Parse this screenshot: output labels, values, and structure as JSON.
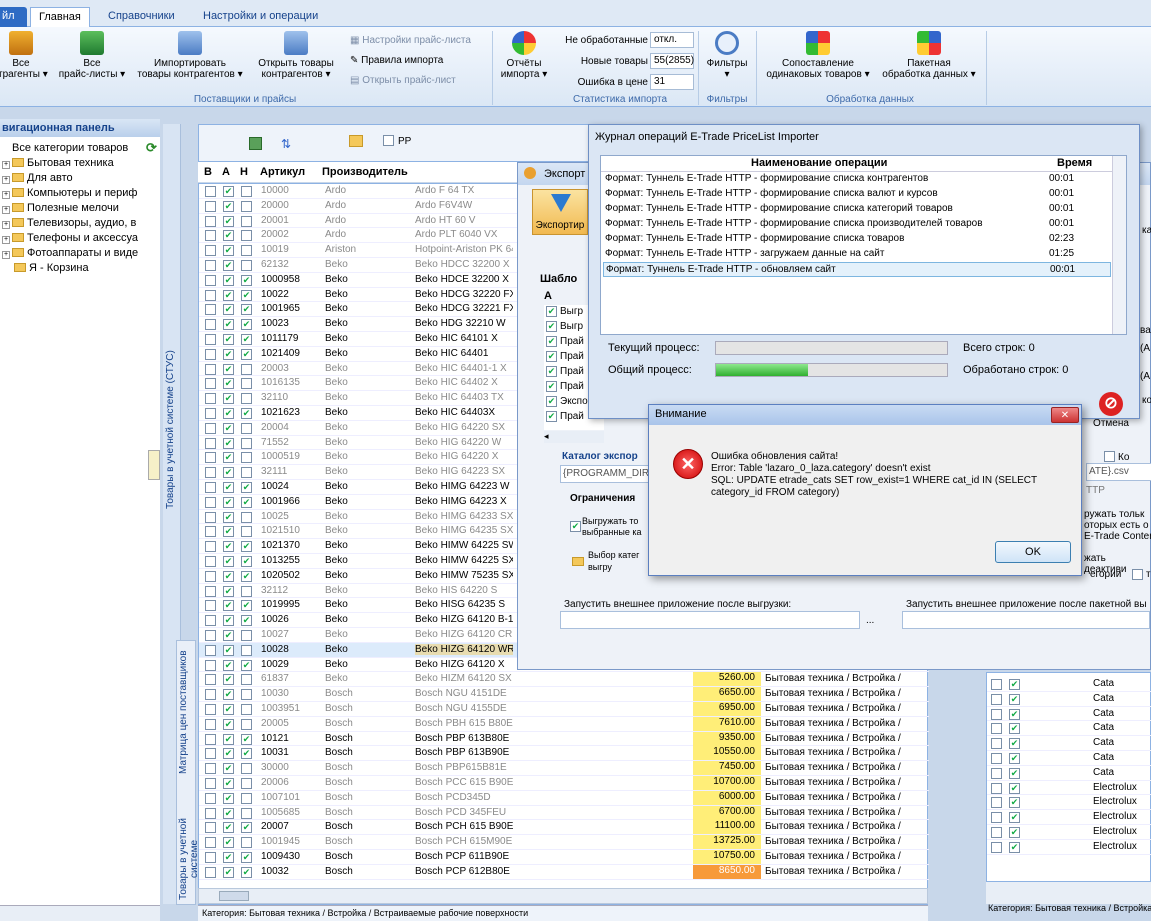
{
  "ribbon": {
    "tabs": [
      "йл",
      "Главная",
      "Справочники",
      "Настройки и операции"
    ],
    "buttons": {
      "all_contractors": "Все\nтрагенты ▾",
      "all_pricelists": "Все\nпрайс-листы ▾",
      "import": "Импортировать\nтовары контрагентов ▾",
      "open_goods": "Открыть товары\nконтрагентов ▾",
      "pricelist_settings": "Настройки прайс-листа",
      "import_rules": "Правила импорта",
      "open_pricelist": "Открыть прайс-лист",
      "import_reports": "Отчёты\nимпорта ▾",
      "filters": "Фильтры\n▾",
      "match": "Сопоставление\nодинаковых товаров ▾",
      "batch": "Пакетная\nобработка данных ▾"
    },
    "stats": {
      "unprocessed_label": "Не обработанные",
      "unprocessed_value": "откл.",
      "new_label": "Новые товары",
      "new_value": "55(2855)",
      "price_err_label": "Ошибка в цене",
      "price_err_value": "31"
    },
    "groups": [
      "Поставщики и прайсы",
      "Статистика импорта",
      "Фильтры",
      "Обработка данных"
    ]
  },
  "nav": {
    "title": "вигационная панель",
    "items": [
      "Все категории товаров",
      "Бытовая техника",
      "Для авто",
      "Компьютеры и периф",
      "Полезные мелочи",
      "Телевизоры, аудио, в",
      "Телефоны и аксессуа",
      "Фотоаппараты и виде",
      "Я - Корзина"
    ]
  },
  "side_tabs": {
    "top": "Товары в учетной системе (СТУС)",
    "matrix": "Матрица цен поставщиков",
    "bottom": "Товары в учетной системе"
  },
  "grid": {
    "toolbar_pp": "PP",
    "headers": [
      "В",
      "А",
      "Н",
      "Артикул",
      "Производитель"
    ],
    "rows": [
      {
        "a": true,
        "n": false,
        "art": "10000",
        "mfr": "Ardo",
        "name": "Ardo F 64 TX",
        "gray": true
      },
      {
        "a": true,
        "n": false,
        "art": "20000",
        "mfr": "Ardo",
        "name": "Ardo F6V4W",
        "gray": true
      },
      {
        "a": true,
        "n": false,
        "art": "20001",
        "mfr": "Ardo",
        "name": "Ardo HT 60 V",
        "gray": true
      },
      {
        "a": true,
        "n": false,
        "art": "20002",
        "mfr": "Ardo",
        "name": "Ardo PLT 6040 VX",
        "gray": true
      },
      {
        "a": true,
        "n": false,
        "art": "10019",
        "mfr": "Ariston",
        "name": "Hotpoint-Ariston PK 64",
        "gray": true
      },
      {
        "a": true,
        "n": false,
        "art": "62132",
        "mfr": "Beko",
        "name": "Beko HDCC 32200 X",
        "gray": true
      },
      {
        "a": true,
        "n": true,
        "art": "1000958",
        "mfr": "Beko",
        "name": "Beko HDCE 32200 X",
        "gray": false
      },
      {
        "a": true,
        "n": true,
        "art": "10022",
        "mfr": "Beko",
        "name": "Beko HDCG 32220 FX",
        "gray": false
      },
      {
        "a": true,
        "n": true,
        "art": "1001965",
        "mfr": "Beko",
        "name": "Beko HDCG 32221 FX",
        "gray": false
      },
      {
        "a": true,
        "n": true,
        "art": "10023",
        "mfr": "Beko",
        "name": "Beko HDG 32210 W",
        "gray": false
      },
      {
        "a": true,
        "n": true,
        "art": "1011179",
        "mfr": "Beko",
        "name": "Beko HIC 64101 X",
        "gray": false
      },
      {
        "a": true,
        "n": true,
        "art": "1021409",
        "mfr": "Beko",
        "name": "Beko HIC 64401",
        "gray": false
      },
      {
        "a": true,
        "n": false,
        "art": "20003",
        "mfr": "Beko",
        "name": "Beko HIC 64401-1 X",
        "gray": true
      },
      {
        "a": true,
        "n": false,
        "art": "1016135",
        "mfr": "Beko",
        "name": "Beko HIC 64402 X",
        "gray": true
      },
      {
        "a": true,
        "n": false,
        "art": "32110",
        "mfr": "Beko",
        "name": "Beko HIC 64403 TX",
        "gray": true
      },
      {
        "a": true,
        "n": true,
        "art": "1021623",
        "mfr": "Beko",
        "name": "Beko HIC 64403X",
        "gray": false
      },
      {
        "a": true,
        "n": false,
        "art": "20004",
        "mfr": "Beko",
        "name": "Beko HIG 64220 SX",
        "gray": true
      },
      {
        "a": true,
        "n": false,
        "art": "71552",
        "mfr": "Beko",
        "name": "Beko HIG 64220 W",
        "gray": true
      },
      {
        "a": true,
        "n": false,
        "art": "1000519",
        "mfr": "Beko",
        "name": "Beko HIG 64220 X",
        "gray": true
      },
      {
        "a": true,
        "n": false,
        "art": "32111",
        "mfr": "Beko",
        "name": "Beko HIG 64223 SX",
        "gray": true
      },
      {
        "a": true,
        "n": true,
        "art": "10024",
        "mfr": "Beko",
        "name": "Beko HIMG 64223 W",
        "gray": false
      },
      {
        "a": true,
        "n": true,
        "art": "1001966",
        "mfr": "Beko",
        "name": "Beko HIMG 64223 X",
        "gray": false
      },
      {
        "a": true,
        "n": false,
        "art": "10025",
        "mfr": "Beko",
        "name": "Beko HIMG 64233 SX",
        "gray": true
      },
      {
        "a": true,
        "n": false,
        "art": "1021510",
        "mfr": "Beko",
        "name": "Beko HIMG 64235 SX",
        "gray": true
      },
      {
        "a": true,
        "n": true,
        "art": "1021370",
        "mfr": "Beko",
        "name": "Beko HIMW 64225 SW",
        "gray": false
      },
      {
        "a": true,
        "n": true,
        "art": "1013255",
        "mfr": "Beko",
        "name": "Beko HIMW 64225 SX",
        "gray": false
      },
      {
        "a": true,
        "n": true,
        "art": "1020502",
        "mfr": "Beko",
        "name": "Beko HIMW 75235 SX",
        "gray": false
      },
      {
        "a": true,
        "n": false,
        "art": "32112",
        "mfr": "Beko",
        "name": "Beko HIS 64220 S",
        "gray": true
      },
      {
        "a": true,
        "n": true,
        "art": "1019995",
        "mfr": "Beko",
        "name": "Beko HISG 64235 S",
        "gray": false
      },
      {
        "a": true,
        "n": true,
        "art": "10026",
        "mfr": "Beko",
        "name": "Beko HIZG 64120 B-1",
        "gray": false
      },
      {
        "a": true,
        "n": false,
        "art": "10027",
        "mfr": "Beko",
        "name": "Beko HIZG 64120 CR",
        "gray": true
      },
      {
        "a": true,
        "n": false,
        "art": "10028",
        "mfr": "Beko",
        "name": "Beko HIZG 64120 WR",
        "gray": false,
        "sel": true
      },
      {
        "a": true,
        "n": true,
        "art": "10029",
        "mfr": "Beko",
        "name": "Beko HIZG 64120 X",
        "gray": false
      },
      {
        "a": true,
        "n": false,
        "art": "61837",
        "mfr": "Beko",
        "name": "Beko HIZM 64120 SX",
        "gray": true,
        "price": "5260.00",
        "cat": "Бытовая техника / Встройка /"
      },
      {
        "a": true,
        "n": false,
        "art": "10030",
        "mfr": "Bosch",
        "name": "Bosch NGU 4151DE",
        "gray": true,
        "price": "6650.00",
        "cat": "Бытовая техника / Встройка /"
      },
      {
        "a": true,
        "n": false,
        "art": "1003951",
        "mfr": "Bosch",
        "name": "Bosch NGU 4155DE",
        "gray": true,
        "price": "6950.00",
        "cat": "Бытовая техника / Встройка /"
      },
      {
        "a": true,
        "n": false,
        "art": "20005",
        "mfr": "Bosch",
        "name": "Bosch PBH 615 B80E",
        "gray": true,
        "price": "7610.00",
        "cat": "Бытовая техника / Встройка /"
      },
      {
        "a": true,
        "n": true,
        "art": "10121",
        "mfr": "Bosch",
        "name": "Bosch PBP 613B80E",
        "gray": false,
        "price": "9350.00",
        "cat": "Бытовая техника / Встройка /"
      },
      {
        "a": true,
        "n": true,
        "art": "10031",
        "mfr": "Bosch",
        "name": "Bosch PBP 613B90E",
        "gray": false,
        "price": "10550.00",
        "cat": "Бытовая техника / Встройка /"
      },
      {
        "a": true,
        "n": false,
        "art": "30000",
        "mfr": "Bosch",
        "name": "Bosch PBP615B81E",
        "gray": true,
        "price": "7450.00",
        "cat": "Бытовая техника / Встройка /"
      },
      {
        "a": true,
        "n": false,
        "art": "20006",
        "mfr": "Bosch",
        "name": "Bosch PCC 615 B90E",
        "gray": true,
        "price": "10700.00",
        "cat": "Бытовая техника / Встройка /"
      },
      {
        "a": true,
        "n": false,
        "art": "1007101",
        "mfr": "Bosch",
        "name": "Bosch PCD345D",
        "gray": true,
        "price": "6000.00",
        "cat": "Бытовая техника / Встройка /"
      },
      {
        "a": true,
        "n": false,
        "art": "1005685",
        "mfr": "Bosch",
        "name": "Bosch PCD 345FEU",
        "gray": true,
        "price": "6700.00",
        "cat": "Бытовая техника / Встройка /"
      },
      {
        "a": true,
        "n": true,
        "art": "20007",
        "mfr": "Bosch",
        "name": "Bosch PCH 615 B90E",
        "gray": false,
        "price": "11100.00",
        "cat": "Бытовая техника / Встройка /"
      },
      {
        "a": true,
        "n": false,
        "art": "1001945",
        "mfr": "Bosch",
        "name": "Bosch PCH 615M90E",
        "gray": true,
        "price": "13725.00",
        "cat": "Бытовая техника / Встройка /"
      },
      {
        "a": true,
        "n": true,
        "art": "1009430",
        "mfr": "Bosch",
        "name": "Bosch PCP 611B90E",
        "gray": false,
        "price": "10750.00",
        "cat": "Бытовая техника / Встройка /"
      },
      {
        "a": true,
        "n": true,
        "art": "10032",
        "mfr": "Bosch",
        "name": "Bosch PCP 612B80E",
        "gray": false,
        "price": "8650.00",
        "cat": "Бытовая техника / Встройка /",
        "orange": true
      }
    ]
  },
  "right_grid": {
    "rows": [
      "Cata",
      "Cata",
      "Cata",
      "Cata",
      "Cata",
      "Cata",
      "Cata",
      "Electrolux",
      "Electrolux",
      "Electrolux",
      "Electrolux",
      "Electrolux"
    ],
    "status": "Категория: Бытовая техника / Встройка /"
  },
  "status": "Категория: Бытовая техника / Встройка / Встраиваемые рабочие поверхности",
  "export_window": {
    "title": "Экспорт",
    "button": "Экспортир",
    "template": "Шабло",
    "col_a": "А",
    "rows": [
      "Выгр",
      "Выгр",
      "Прай",
      "Прай",
      "Прай",
      "Прай",
      "Экспо",
      "Прай"
    ],
    "catalog_label": "Каталог экспор",
    "catalog_value": "{PROGRAMM_DIR}",
    "limits": "Ограничения",
    "upload_selected": "Выгружать то\nвыбранные ка",
    "choose_cat": "Выбор катег\nвыгру",
    "run_after": "Запустить внешнее приложение после выгрузки:",
    "run_after_batch": "Запустить внешнее приложение после пакетной вы",
    "browse": "...",
    "right_texts": [
      "Ко",
      "ATE}.csv",
      "TTP",
      "ружать тольк\nоторых есть о\nE-Trade Conter",
      "жать деактиви",
      "егории",
      "т",
      "вар",
      "(А",
      "(А",
      "ко",
      "ка"
    ]
  },
  "journal": {
    "title": "Журнал операций E-Trade PriceList Importer",
    "col_name": "Наименование операции",
    "col_time": "Время",
    "rows": [
      {
        "name": "Формат: Туннель E-Trade HTTP - формирование списка контрагентов",
        "time": "00:01"
      },
      {
        "name": "Формат: Туннель E-Trade HTTP - формирование списка валют и курсов",
        "time": "00:01"
      },
      {
        "name": "Формат: Туннель E-Trade HTTP - формирование списка категорий товаров",
        "time": "00:01"
      },
      {
        "name": "Формат: Туннель E-Trade HTTP - формирование списка производителей товаров",
        "time": "00:01"
      },
      {
        "name": "Формат: Туннель E-Trade HTTP - формирование списка товаров",
        "time": "02:23"
      },
      {
        "name": "Формат: Туннель E-Trade HTTP - загружаем данные на сайт",
        "time": "01:25"
      },
      {
        "name": "Формат: Туннель E-Trade HTTP - обновляем сайт",
        "time": "00:01"
      }
    ],
    "current_label": "Текущий процесс:",
    "overall_label": "Общий процесс:",
    "total_rows": "Всего строк: 0",
    "processed_rows": "Обработано строк: 0",
    "overall_progress": 0.4,
    "cancel": "Отмена"
  },
  "alert": {
    "title": "Внимание",
    "line1": "Ошибка обновления сайта!",
    "line2": "Error: Table 'lazaro_0_laza.category' doesn't exist",
    "line3": " SQL: UPDATE etrade_cats SET row_exist=1 WHERE cat_id IN (SELECT",
    "line4": "category_id FROM category)",
    "ok": "OK",
    "close": "✕"
  }
}
